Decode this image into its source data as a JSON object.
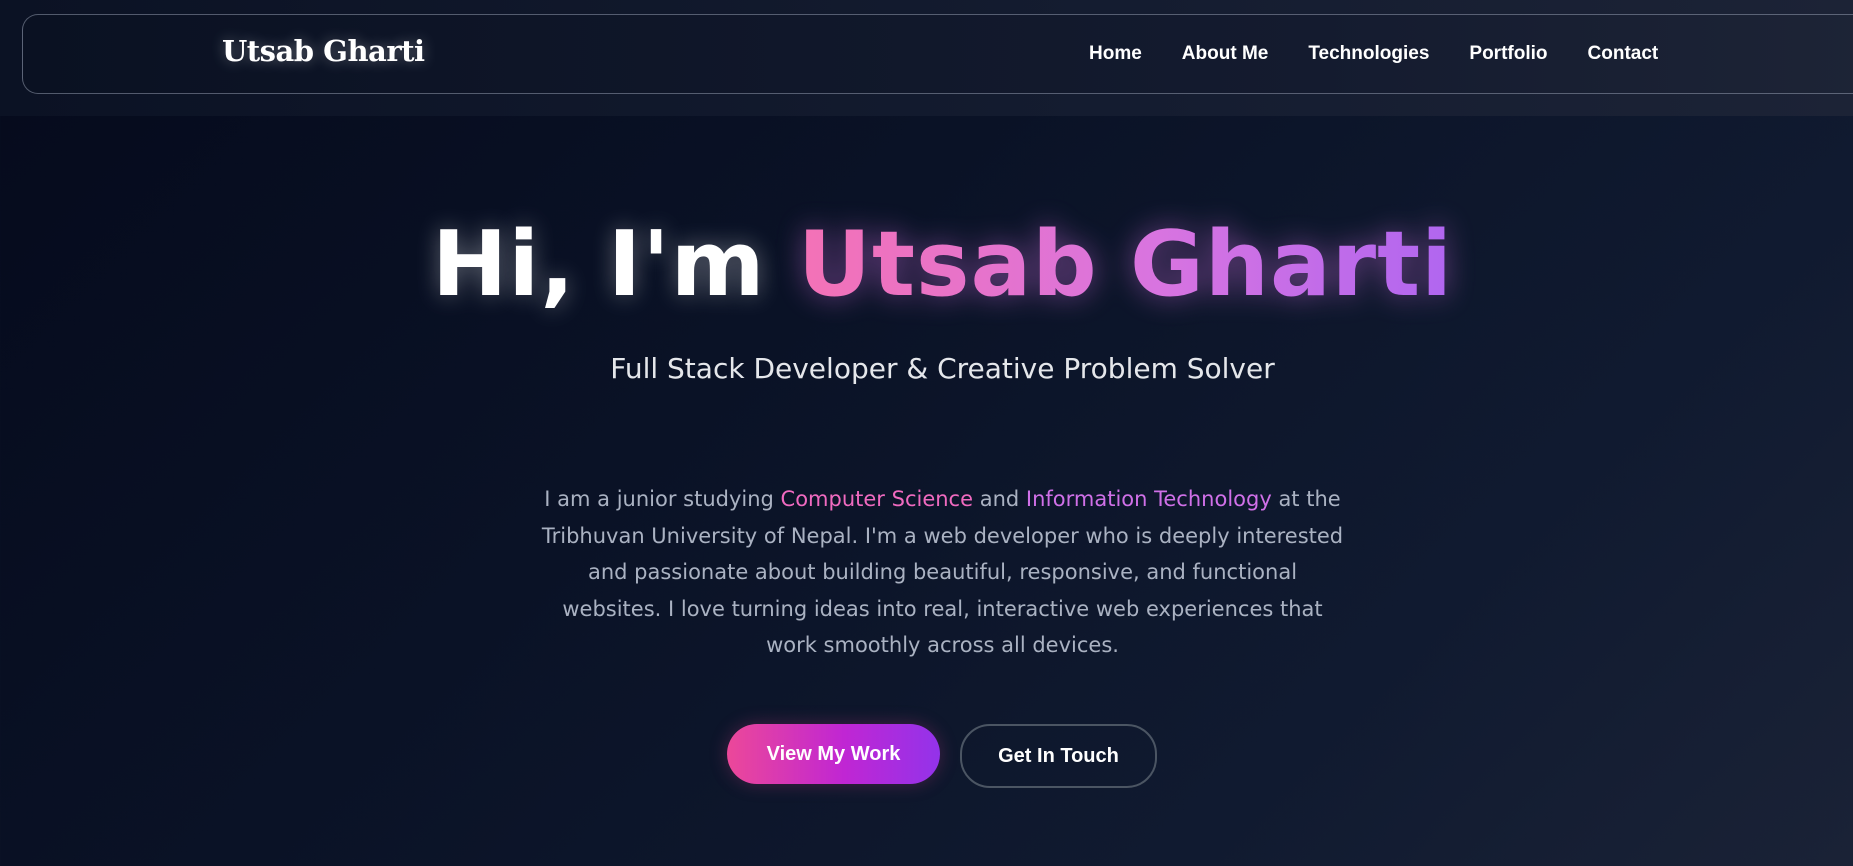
{
  "nav": {
    "brand": "Utsab Gharti",
    "links": [
      "Home",
      "About Me",
      "Technologies",
      "Portfolio",
      "Contact"
    ]
  },
  "hero": {
    "greeting": "Hi, I'm ",
    "name": "Utsab Gharti",
    "subtitle": "Full Stack Developer & Creative Problem Solver",
    "bio": {
      "part1": "I am a junior studying ",
      "highlight1": "Computer Science",
      "part2": " and ",
      "highlight2": "Information Technology",
      "part3": " at the Tribhuvan University of Nepal. I'm a web developer who is deeply interested and passionate about building beautiful, responsive, and functional websites. I love turning ideas into real, interactive web experiences that work smoothly across all devices."
    },
    "primary_button": "View My Work",
    "secondary_button": "Get In Touch"
  },
  "colors": {
    "accent_pink": "#ec4899",
    "accent_purple": "#9333ea",
    "background": "#0a1226"
  }
}
